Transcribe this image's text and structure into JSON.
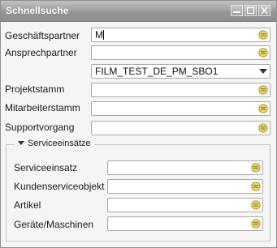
{
  "window": {
    "title": "Schnellsuche"
  },
  "fields": {
    "geschaeftspartner": {
      "label": "Geschäftspartner",
      "value": "M"
    },
    "ansprechpartner": {
      "label": "Ansprechpartner",
      "value": ""
    },
    "ansprechpartner_select": {
      "value": "FILM_TEST_DE_PM_SBO1"
    },
    "projektstamm": {
      "label": "Projektstamm",
      "value": ""
    },
    "mitarbeiterstamm": {
      "label": "Mitarbeiterstamm",
      "value": ""
    },
    "supportvorgang": {
      "label": "Supportvorgang",
      "value": ""
    }
  },
  "serviceeinsaetze": {
    "title": "Serviceeinsätze",
    "serviceeinsatz": {
      "label": "Serviceeinsatz",
      "value": ""
    },
    "kundenserviceobjekt": {
      "label": "Kundenserviceobjekt",
      "value": ""
    },
    "artikel": {
      "label": "Artikel",
      "value": ""
    },
    "geraete": {
      "label": "Geräte/Maschinen",
      "value": ""
    }
  },
  "icons": {
    "lookup": "lookup-icon",
    "dropdown": "chevron-down-icon",
    "collapse": "triangle-down-icon",
    "minimize": "minimize-icon",
    "maximize": "maximize-icon",
    "close": "close-icon"
  }
}
